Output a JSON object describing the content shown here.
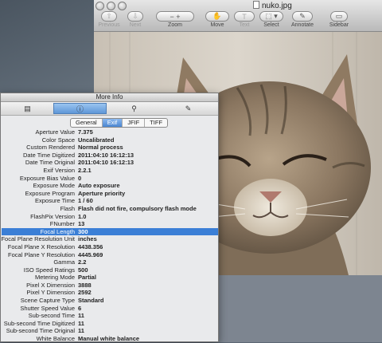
{
  "preview": {
    "title": "nuko.jpg",
    "toolbar": [
      {
        "label": "Previous",
        "glyph": "⇧"
      },
      {
        "label": "Next",
        "glyph": "⇩"
      },
      {
        "label": "Zoom",
        "glyph": "−   +"
      },
      {
        "label": "Move",
        "glyph": "✋"
      },
      {
        "label": "Text",
        "glyph": "T"
      },
      {
        "label": "Select",
        "glyph": "⬚ ▾"
      },
      {
        "label": "Annotate",
        "glyph": "✎"
      },
      {
        "label": "Sidebar",
        "glyph": "▭"
      }
    ]
  },
  "info": {
    "title": "More Info",
    "tab_icons": [
      "document-icon",
      "info-icon",
      "magnifier-icon",
      "pencil-icon"
    ],
    "tab_glyphs": [
      "▤",
      "ⓘ",
      "⚲",
      "✎"
    ],
    "subtabs": [
      "General",
      "Exif",
      "JFIF",
      "TIFF"
    ],
    "selected_subtab": "Exif",
    "rows": [
      {
        "key": "Aperture Value",
        "value": "7.375"
      },
      {
        "key": "Color Space",
        "value": "Uncalibrated"
      },
      {
        "key": "Custom Rendered",
        "value": "Normal process"
      },
      {
        "key": "Date Time Digitized",
        "value": "2011:04:10 16:12:13"
      },
      {
        "key": "Date Time Original",
        "value": "2011:04:10 16:12:13"
      },
      {
        "key": "Exif Version",
        "value": "2.2.1"
      },
      {
        "key": "Exposure Bias Value",
        "value": "0"
      },
      {
        "key": "Exposure Mode",
        "value": "Auto exposure"
      },
      {
        "key": "Exposure Program",
        "value": "Aperture priority"
      },
      {
        "key": "Exposure Time",
        "value": "1 / 60"
      },
      {
        "key": "Flash",
        "value": "Flash did not fire, compulsory flash mode"
      },
      {
        "key": "FlashPix Version",
        "value": "1.0"
      },
      {
        "key": "FNumber",
        "value": "13"
      },
      {
        "key": "Focal Length",
        "value": "300",
        "selected": true
      },
      {
        "key": "Focal Plane Resolution Unit",
        "value": "inches"
      },
      {
        "key": "Focal Plane X Resolution",
        "value": "4438.356"
      },
      {
        "key": "Focal Plane Y Resolution",
        "value": "4445.969"
      },
      {
        "key": "Gamma",
        "value": "2.2"
      },
      {
        "key": "ISO Speed Ratings",
        "value": "500"
      },
      {
        "key": "Metering Mode",
        "value": "Partial"
      },
      {
        "key": "Pixel X Dimension",
        "value": "3888"
      },
      {
        "key": "Pixel Y Dimension",
        "value": "2592"
      },
      {
        "key": "Scene Capture Type",
        "value": "Standard"
      },
      {
        "key": "Shutter Speed Value",
        "value": "6"
      },
      {
        "key": "Sub-second Time",
        "value": "11"
      },
      {
        "key": "Sub-second Time Digitized",
        "value": "11"
      },
      {
        "key": "Sub-second Time Original",
        "value": "11"
      },
      {
        "key": "White Balance",
        "value": "Manual white balance"
      }
    ]
  },
  "colors": {
    "selection": "#3b7fd6",
    "tab_selected": "#5f97d8"
  }
}
